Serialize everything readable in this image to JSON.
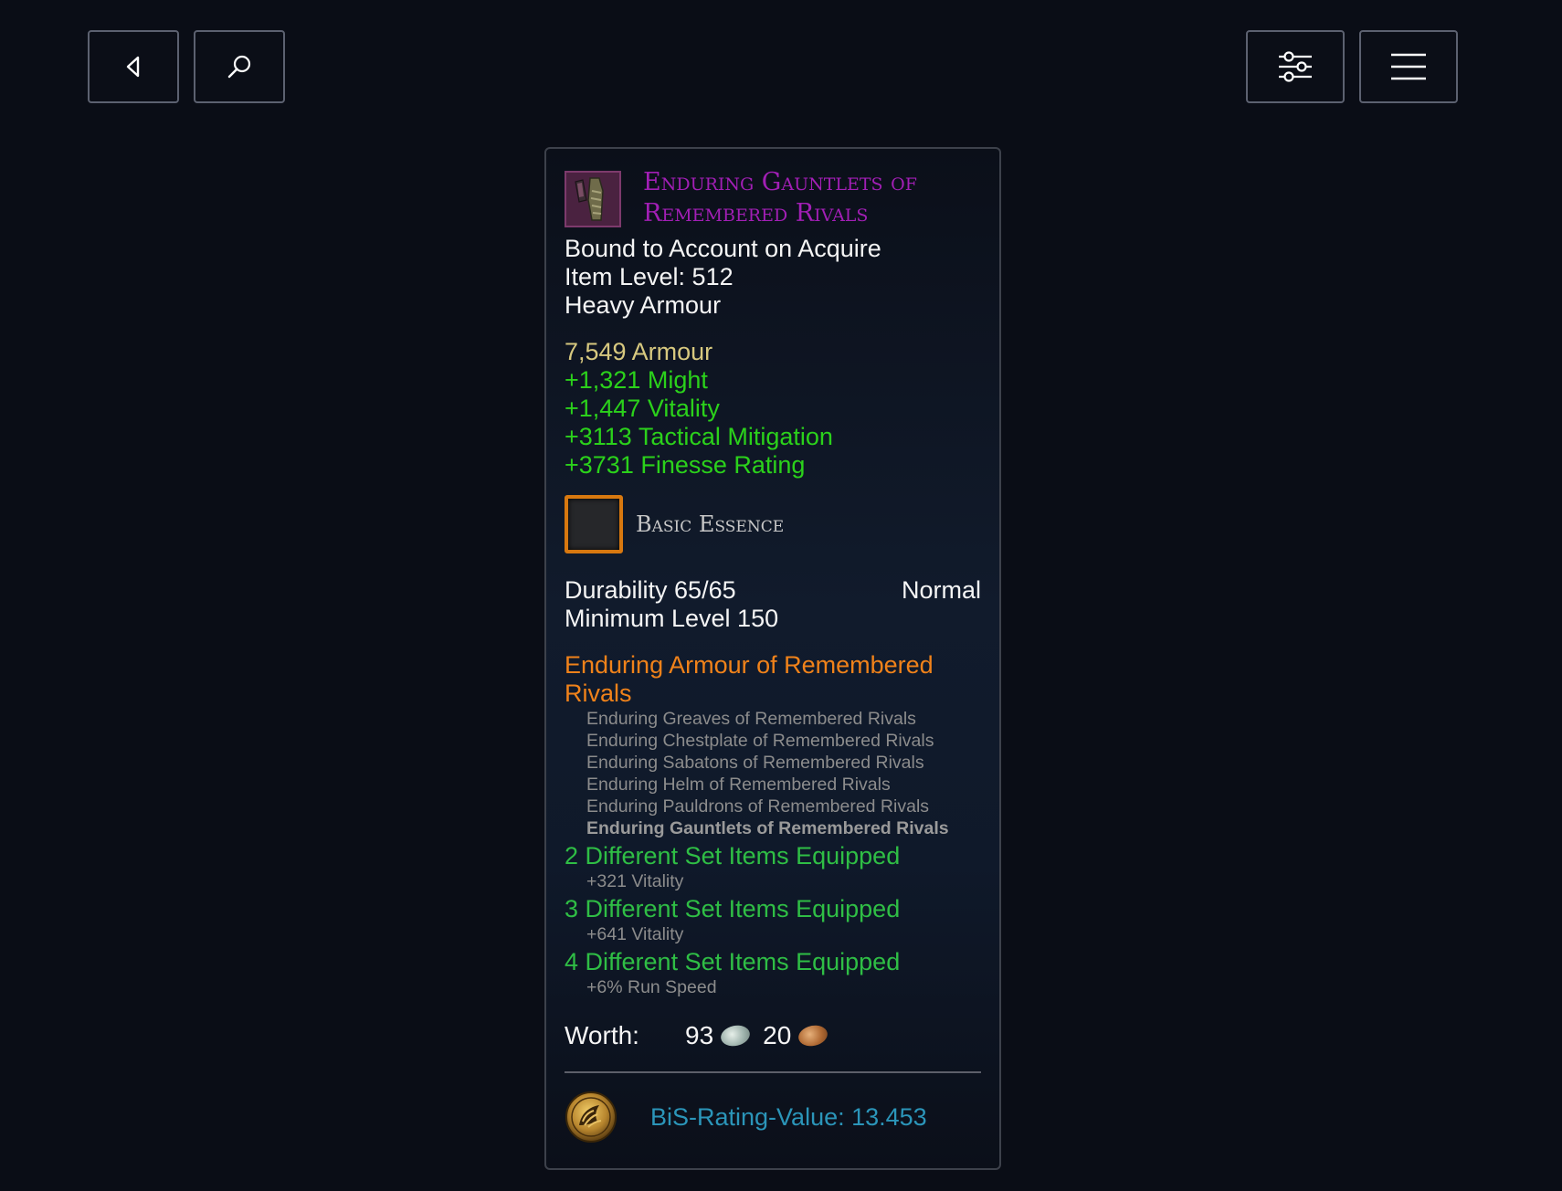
{
  "toolbar": {
    "back_icon": "chevron-left-icon",
    "search_icon": "search-icon",
    "filter_icon": "sliders-icon",
    "menu_icon": "hamburger-menu-icon"
  },
  "item": {
    "name": "Enduring Gauntlets of Remembered Rivals",
    "name_color": "#a21fb5",
    "icon": "gauntlets-icon",
    "binding": "Bound to Account on Acquire",
    "item_level": "Item Level: 512",
    "armour_type": "Heavy Armour",
    "armour_value": "7,549 Armour",
    "stats": [
      "+1,321 Might",
      "+1,447 Vitality",
      "+3113 Tactical Mitigation",
      "+3731 Finesse Rating"
    ],
    "essence_slot": "Basic Essence",
    "durability": "Durability 65/65",
    "durability_state": "Normal",
    "min_level": "Minimum Level 150",
    "set": {
      "title": "Enduring Armour of Remembered Rivals",
      "title_color": "#f0821a",
      "items": [
        "Enduring Greaves of Remembered Rivals",
        "Enduring Chestplate of Remembered Rivals",
        "Enduring Sabatons of Remembered Rivals",
        "Enduring Helm of Remembered Rivals",
        "Enduring Pauldrons of Remembered Rivals",
        "Enduring Gauntlets of Remembered Rivals"
      ],
      "bonuses": [
        {
          "heading": "2 Different Set Items Equipped",
          "effect": "+321 Vitality"
        },
        {
          "heading": "3 Different Set Items Equipped",
          "effect": "+641 Vitality"
        },
        {
          "heading": "4 Different Set Items Equipped",
          "effect": "+6% Run Speed"
        }
      ]
    },
    "worth": {
      "label": "Worth:",
      "silver": "93",
      "copper": "20"
    },
    "bis": {
      "icon": "bis-rating-emblem-icon",
      "text": "BiS-Rating-Value: 13.453",
      "color": "#2b95b9"
    }
  }
}
